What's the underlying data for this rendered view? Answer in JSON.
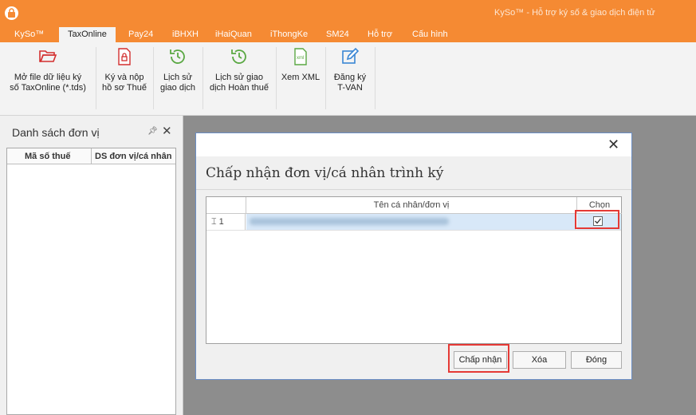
{
  "window": {
    "title": "KySo™ - Hỗ trợ ký số & giao dịch điện tử"
  },
  "ribbon_tabs": [
    "KySo™",
    "TaxOnline",
    "Pay24",
    "iBHXH",
    "iHaiQuan",
    "iThongKe",
    "SM24",
    "Hỗ trợ",
    "Cấu hình"
  ],
  "active_tab": "TaxOnline",
  "ribbon_buttons": [
    {
      "icon": "folder-open-icon",
      "line1": "Mở file dữ liệu ký",
      "line2": "số TaxOnline (*.tds)"
    },
    {
      "icon": "signed-document-icon",
      "line1": "Ký và nộp",
      "line2": "hồ sơ Thuế"
    },
    {
      "icon": "history-clock-icon",
      "line1": "Lịch sử",
      "line2": "giao dịch"
    },
    {
      "icon": "refund-history-icon",
      "line1": "Lịch sử giao",
      "line2": "dịch Hoàn thuế"
    },
    {
      "icon": "xml-file-icon",
      "line1": "Xem XML",
      "line2": ""
    },
    {
      "icon": "edit-register-icon",
      "line1": "Đăng ký",
      "line2": "T-VAN"
    }
  ],
  "colors": {
    "accent": "#f58a33",
    "highlight": "#e53935",
    "row_selected": "#d8e8f8"
  },
  "left_panel": {
    "title": "Danh sách đơn vị",
    "pin_icon": "pin-icon",
    "columns": [
      "Mã số thuế",
      "DS đơn vị/cá nhân"
    ]
  },
  "dialog": {
    "title": "Chấp nhận đơn vị/cá nhân trình ký",
    "grid": {
      "headers": {
        "name": "Tên cá nhân/đơn vị",
        "select": "Chọn"
      },
      "rows": [
        {
          "row_label": "1",
          "checked": true
        }
      ]
    },
    "buttons": {
      "accept": "Chấp nhận",
      "delete": "Xóa",
      "close": "Đóng"
    }
  }
}
